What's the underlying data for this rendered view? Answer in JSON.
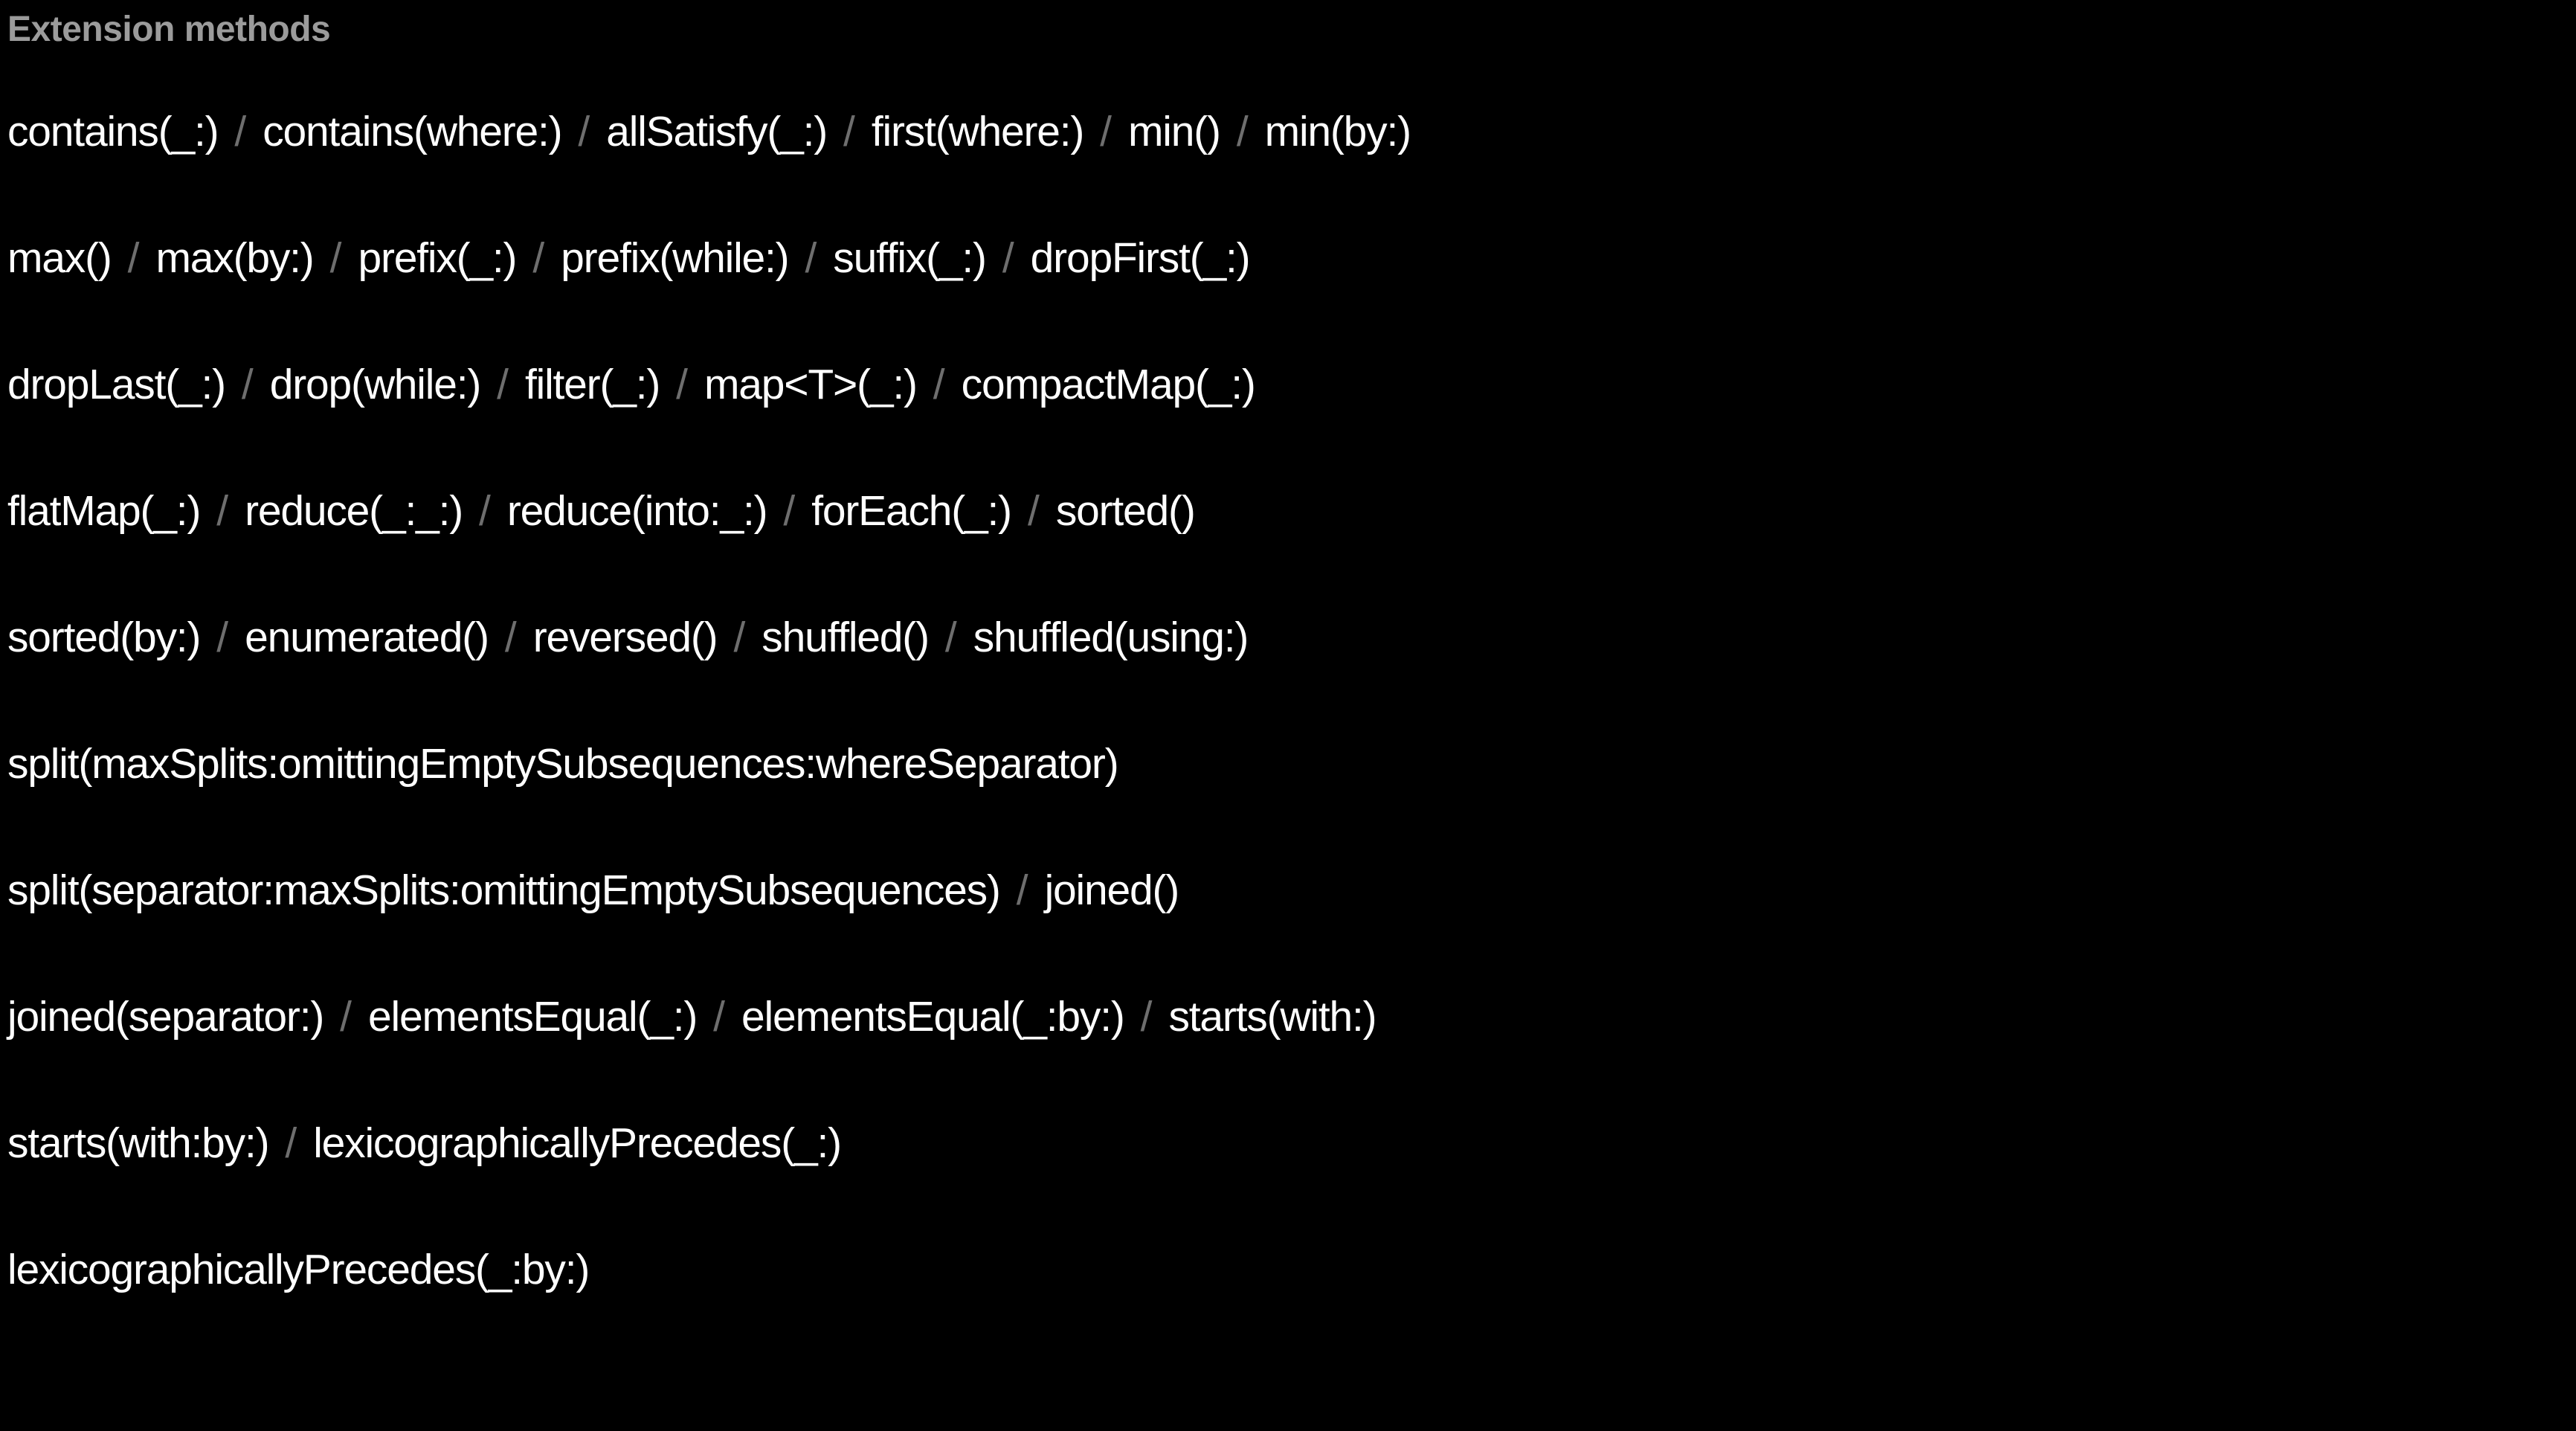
{
  "slide": {
    "background_color": "#000000",
    "title": "Extension methods",
    "title_color": "#9b9b9b",
    "text_color": "#ffffff",
    "separator_color": "#6e6e6e",
    "separator_glyph": "/"
  },
  "lines": [
    {
      "index": 0,
      "text": "contains(_:)  /  contains(where:)  /  allSatisfy(_:)  /  first(where:)  /  min()  /  min(by:)",
      "items": [
        "contains(_:)",
        "contains(where:)",
        "allSatisfy(_:)",
        "first(where:)",
        "min()",
        "min(by:)"
      ]
    },
    {
      "index": 1,
      "text": "max()  /  max(by:)  /  prefix(_:)  /  prefix(while:)  /  suffix(_:)  /  dropFirst(_:)",
      "items": [
        "max()",
        "max(by:)",
        "prefix(_:)",
        "prefix(while:)",
        "suffix(_:)",
        "dropFirst(_:)"
      ]
    },
    {
      "index": 2,
      "text": "dropLast(_:)  /  drop(while:)  /  filter(_:)  /  map<T>(_:)  /  compactMap(_:)",
      "items": [
        "dropLast(_:)",
        "drop(while:)",
        "filter(_:)",
        "map<T>(_:)",
        "compactMap(_:)"
      ]
    },
    {
      "index": 3,
      "text": "flatMap(_:)  /  reduce(_:_:)  /  reduce(into:_:)  /  forEach(_:)  /  sorted()",
      "items": [
        "flatMap(_:)",
        "reduce(_:_:)",
        "reduce(into:_:)",
        "forEach(_:)",
        "sorted()"
      ]
    },
    {
      "index": 4,
      "text": "sorted(by:)  /  enumerated()  /  reversed()  /  shuffled()  /  shuffled(using:)",
      "items": [
        "sorted(by:)",
        "enumerated()",
        "reversed()",
        "shuffled()",
        "shuffled(using:)"
      ]
    },
    {
      "index": 5,
      "text": "split(maxSplits:omittingEmptySubsequences:whereSeparator)",
      "items": [
        "split(maxSplits:omittingEmptySubsequences:whereSeparator)"
      ]
    },
    {
      "index": 6,
      "text": "split(separator:maxSplits:omittingEmptySubsequences)  /  joined()",
      "items": [
        "split(separator:maxSplits:omittingEmptySubsequences)",
        "joined()"
      ]
    },
    {
      "index": 7,
      "text": "joined(separator:)  /  elementsEqual(_:)  /  elementsEqual(_:by:)  /  starts(with:)",
      "items": [
        "joined(separator:)",
        "elementsEqual(_:)",
        "elementsEqual(_:by:)",
        "starts(with:)"
      ]
    },
    {
      "index": 8,
      "text": "starts(with:by:)  /  lexicographicallyPrecedes(_:)",
      "items": [
        "starts(with:by:)",
        "lexicographicallyPrecedes(_:)"
      ]
    },
    {
      "index": 9,
      "text": "lexicographicallyPrecedes(_:by:)",
      "items": [
        "lexicographicallyPrecedes(_:by:)"
      ]
    }
  ]
}
